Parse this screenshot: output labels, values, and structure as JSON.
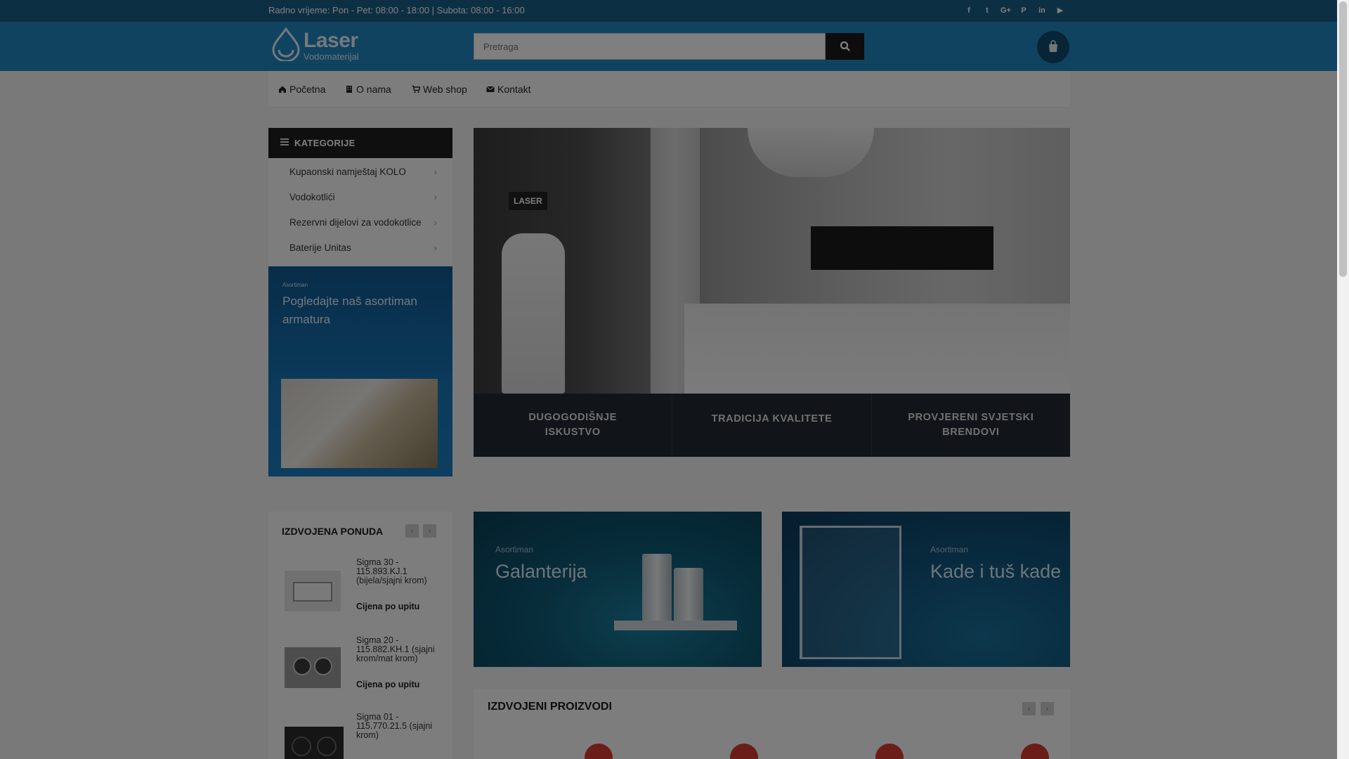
{
  "topbar": {
    "hours_text": "Radno vrijeme: Pon - Pet: 08:00 - 18:00 | Subota: 08:00 - 16:00",
    "social_icons": [
      "facebook-icon",
      "twitter-icon",
      "google-plus-icon",
      "pinterest-icon",
      "linkedin-icon",
      "youtube-icon"
    ]
  },
  "header": {
    "logo_word": "Laser",
    "logo_sub": "Vodomaterijal",
    "search_placeholder": "Pretraga",
    "search_icon": "search-icon",
    "cart_icon": "shopping-bag-icon"
  },
  "nav": {
    "items": [
      {
        "label": "Početna",
        "icon": "home-icon"
      },
      {
        "label": "O nama",
        "icon": "building-icon"
      },
      {
        "label": "Web shop",
        "icon": "cart-icon"
      },
      {
        "label": "Kontakt",
        "icon": "envelope-icon"
      }
    ]
  },
  "categories": {
    "title": "KATEGORIJE",
    "items": [
      {
        "label": "Kupaonski namještaj KOLO"
      },
      {
        "label": "Vodokotlići"
      },
      {
        "label": "Rezervni dijelovi za vodokotlice"
      },
      {
        "label": "Baterije Unitas"
      }
    ]
  },
  "promo_left": {
    "tag": "Asortiman",
    "headline": "Pogledajte naš asortiman armatura"
  },
  "hero": {
    "badge": "LASER",
    "features": [
      {
        "line1": "DUGOGODIŠNJE",
        "line2": "ISKUSTVO"
      },
      {
        "line1": "TRADICIJA KVALITETE",
        "line2": ""
      },
      {
        "line1": "PROVJERENI SVJETSKI",
        "line2": "BRENDOVI"
      }
    ]
  },
  "featured_offer": {
    "title": "IZDVOJENA PONUDA",
    "items": [
      {
        "name": "Sigma 30 - 115.893.KJ.1 (bijela/sjajni krom)",
        "price": "Cijena po upitu"
      },
      {
        "name": "Sigma 20 - 115.882.KH.1 (sjajni krom/mat krom)",
        "price": "Cijena po upitu"
      },
      {
        "name": "Sigma 01 - 115.770.21.5 (sjajni krom)",
        "price": ""
      }
    ]
  },
  "banners": [
    {
      "tag": "Asortiman",
      "headline": "Galanterija"
    },
    {
      "tag": "Asortiman",
      "headline": "Kade i tuš kade"
    }
  ],
  "featured_products": {
    "title": "IZDVOJENI PROIZVODI"
  },
  "colors": {
    "topbar": "#1a5f88",
    "header": "#1e86c0",
    "sale": "#d63a35"
  }
}
